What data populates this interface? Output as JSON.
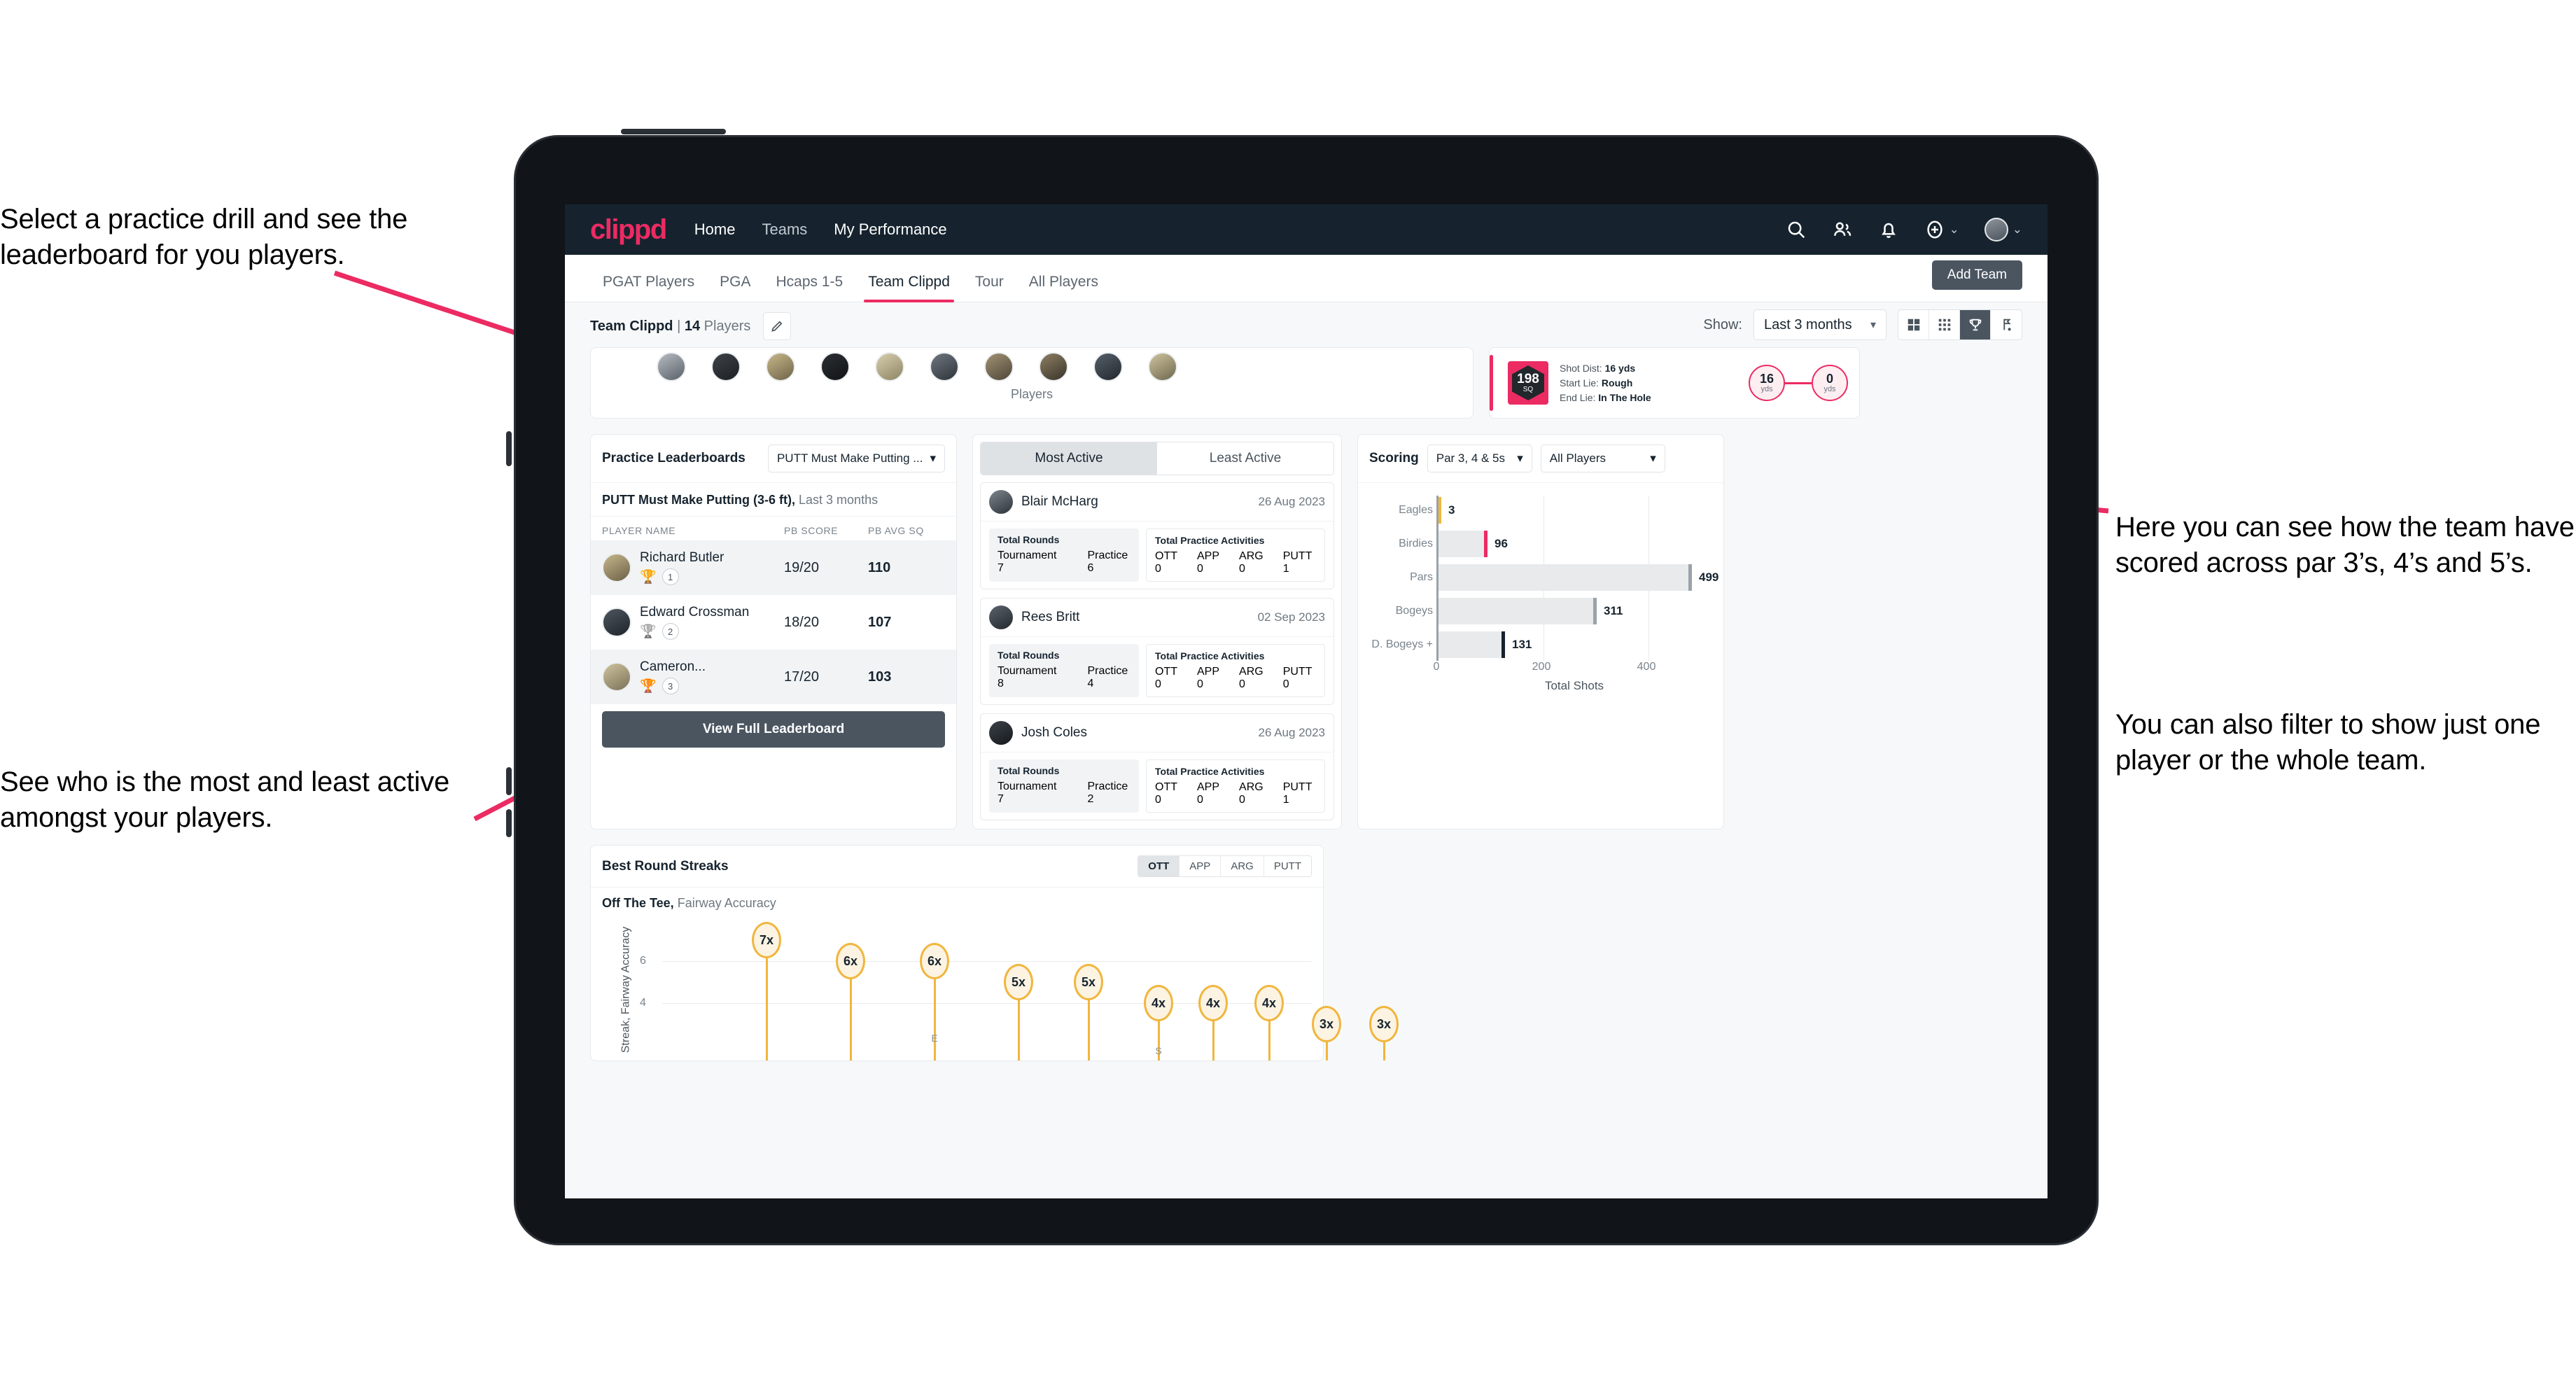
{
  "annotations": {
    "top_left": "Select a practice drill and see the leaderboard for you players.",
    "bottom_left": "See who is the most and least active amongst your players.",
    "right_1": "Here you can see how the team have scored across par 3’s, 4’s and 5’s.",
    "right_2": "You can also filter to show just one player or the whole team."
  },
  "topnav": {
    "logo": "clippd",
    "links": [
      {
        "label": "Home",
        "active": true
      },
      {
        "label": "Teams",
        "active": false
      },
      {
        "label": "My Performance",
        "active": true
      }
    ],
    "icons": [
      "search-icon",
      "people-icon",
      "bell-icon",
      "plus-circle-icon",
      "avatar"
    ],
    "caret": "⌄"
  },
  "tabs": [
    {
      "label": "PGAT Players",
      "active": false
    },
    {
      "label": "PGA",
      "active": false
    },
    {
      "label": "Hcaps 1-5",
      "active": false
    },
    {
      "label": "Team Clippd",
      "active": true
    },
    {
      "label": "Tour",
      "active": false
    },
    {
      "label": "All Players",
      "active": false
    }
  ],
  "add_team_button": "Add Team",
  "team_header": {
    "name": "Team Clippd",
    "separator": "|",
    "count": "14",
    "players_word": "Players",
    "edit_icon": "pencil-icon"
  },
  "show_bar": {
    "label": "Show:",
    "value": "Last 3 months",
    "view_modes": [
      "grid-large-icon",
      "grid-small-icon",
      "trophy-icon",
      "flag-icon"
    ],
    "active_view": "trophy-icon"
  },
  "players_card": {
    "caption": "Players",
    "avatar_count": 10
  },
  "shot_card": {
    "badge_value": "198",
    "badge_unit": "SQ",
    "shot_dist_label": "Shot Dist:",
    "shot_dist_value": "16 yds",
    "start_lie_label": "Start Lie:",
    "start_lie_value": "Rough",
    "end_lie_label": "End Lie:",
    "end_lie_value": "In The Hole",
    "from_value": "16",
    "from_unit": "yds",
    "to_value": "0",
    "to_unit": "yds"
  },
  "leaderboard": {
    "title": "Practice Leaderboards",
    "drill_select": "PUTT Must Make Putting ...",
    "subtitle_bold": "PUTT Must Make Putting (3-6 ft),",
    "subtitle_light": "Last 3 months",
    "columns": [
      "PLAYER NAME",
      "PB SCORE",
      "PB AVG SQ"
    ],
    "rows": [
      {
        "name": "Richard Butler",
        "rank": "1",
        "trophy": "gold",
        "pb_score": "19/20",
        "pb_avg_sq": "110"
      },
      {
        "name": "Edward Crossman",
        "rank": "2",
        "trophy": "silver",
        "pb_score": "18/20",
        "pb_avg_sq": "107"
      },
      {
        "name": "Cameron...",
        "rank": "3",
        "trophy": "bronze",
        "pb_score": "17/20",
        "pb_avg_sq": "103"
      }
    ],
    "view_full_button": "View Full Leaderboard"
  },
  "activity": {
    "tabs": [
      {
        "label": "Most Active",
        "active": true
      },
      {
        "label": "Least Active",
        "active": false
      }
    ],
    "block_a_title": "Total Rounds",
    "block_b_title": "Total Practice Activities",
    "rounds_keys": [
      "Tournament",
      "Practice"
    ],
    "practice_keys": [
      "OTT",
      "APP",
      "ARG",
      "PUTT"
    ],
    "items": [
      {
        "name": "Blair McHarg",
        "date": "26 Aug 2023",
        "rounds": [
          "7",
          "6"
        ],
        "practice": [
          "0",
          "0",
          "0",
          "1"
        ]
      },
      {
        "name": "Rees Britt",
        "date": "02 Sep 2023",
        "rounds": [
          "8",
          "4"
        ],
        "practice": [
          "0",
          "0",
          "0",
          "0"
        ]
      },
      {
        "name": "Josh Coles",
        "date": "26 Aug 2023",
        "rounds": [
          "7",
          "2"
        ],
        "practice": [
          "0",
          "0",
          "0",
          "1"
        ]
      }
    ]
  },
  "scoring": {
    "title": "Scoring",
    "par_select": "Par 3, 4 & 5s",
    "player_select": "All Players"
  },
  "streaks": {
    "title": "Best Round Streaks",
    "segments": [
      {
        "label": "OTT",
        "active": true
      },
      {
        "label": "APP",
        "active": false
      },
      {
        "label": "ARG",
        "active": false
      },
      {
        "label": "PUTT",
        "active": false
      }
    ],
    "subtitle_bold": "Off The Tee,",
    "subtitle_light": "Fairway Accuracy"
  },
  "chart_data": [
    {
      "type": "bar",
      "orientation": "horizontal",
      "title": "Scoring",
      "categories": [
        "Eagles",
        "Birdies",
        "Pars",
        "Bogeys",
        "D. Bogeys +"
      ],
      "values": [
        3,
        96,
        499,
        311,
        131
      ],
      "bar_cap_colors": [
        "#f0b63e",
        "#ec2b63",
        "#9aa2aa",
        "#9aa2aa",
        "#16232e"
      ],
      "xlabel": "Total Shots",
      "ylabel": "",
      "xticks": [
        0,
        200,
        400
      ],
      "xlim": [
        0,
        520
      ],
      "grid": true,
      "legend": "none"
    },
    {
      "type": "scatter",
      "title": "Best Round Streaks",
      "subtitle": "Off The Tee, Fairway Accuracy",
      "ylabel": "Streak, Fairway Accuracy",
      "yticks": [
        4,
        6
      ],
      "ylim": [
        0,
        8
      ],
      "point_labels": [
        "7x",
        "6x",
        "6x",
        "5x",
        "5x",
        "4x",
        "4x",
        "4x",
        "3x",
        "3x"
      ],
      "values": [
        7,
        6,
        6,
        5,
        5,
        4,
        4,
        4,
        3,
        3
      ],
      "grid": true,
      "legend": "none"
    }
  ]
}
